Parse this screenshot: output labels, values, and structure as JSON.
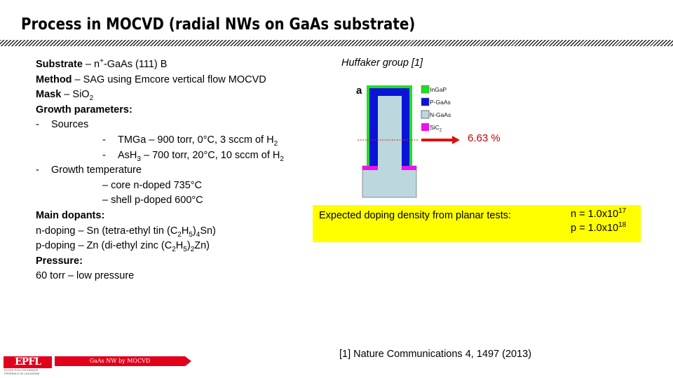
{
  "slide": {
    "title": "Process in MOCVD (radial NWs on GaAs substrate)"
  },
  "left_column": {
    "substrate_label": "Substrate",
    "substrate_value": " – n",
    "substrate_sup": "+",
    "substrate_rest": "-GaAs (111) B",
    "method_label": "Method",
    "method_value": " – SAG using Emcore vertical flow MOCVD",
    "mask_label": "Mask",
    "mask_value": " – SiO",
    "mask_sub": "2",
    "growth_params_label": "Growth parameters:",
    "sources_bullet": "-",
    "sources_label": "Sources",
    "tmga_bullet": "-",
    "tmga_text": "TMGa – 900 torr, 0°C, 3 sccm of H",
    "tmga_sub": "2",
    "ash3_bullet": "-",
    "ash3_a": "AsH",
    "ash3_sub1": "3",
    "ash3_b": " – 700 torr, 20°C, 10 sccm of H",
    "ash3_sub2": "2",
    "growth_temp_bullet": "-",
    "growth_temp_label": "Growth temperature",
    "core_text": "– core n-doped 735°C",
    "shell_text": "– shell p-doped 600°C",
    "dopants_label": "Main dopants:",
    "n_doping_a": "n-doping – Sn (tetra-ethyl tin (C",
    "n_doping_s1": "2",
    "n_doping_b": "H",
    "n_doping_s2": "5",
    "n_doping_c": ")",
    "n_doping_s3": "4",
    "n_doping_d": "Sn)",
    "p_doping_a": "p-doping – Zn (di-ethyl zinc (C",
    "p_doping_s1": "2",
    "p_doping_b": "H",
    "p_doping_s2": "5",
    "p_doping_c": ")",
    "p_doping_s3": "2",
    "p_doping_d": "Zn)",
    "pressure_label": "Pressure:",
    "pressure_value": "60 torr – low pressure"
  },
  "figure": {
    "caption": "Huffaker group [1]",
    "panel_label": "a",
    "legend": [
      {
        "label": "InGaP",
        "color": "#22dd22"
      },
      {
        "label": "P-GaAs",
        "color": "#0a14d8"
      },
      {
        "label": "N-GaAs",
        "color": "#bcd8de"
      },
      {
        "label": "SiC",
        "sub": "2",
        "color": "#ee10ee"
      }
    ],
    "arrow_color": "#e01010",
    "percentage": "6.63 %"
  },
  "highlight": {
    "label": "Expected doping density from planar tests:",
    "n_prefix": "n = 1.0x10",
    "n_exp": "17",
    "p_prefix": "p = 1.0x10",
    "p_exp": "18",
    "color": "#ffff00"
  },
  "reference": "[1] Nature Communications 4, 1497 (2013)",
  "footer": {
    "logo_text": "EPFL",
    "logo_sub1": "ÉCOLE POLYTECHNIQUE",
    "logo_sub2": "FÉDÉRALE DE LAUSANNE",
    "bar_text": "GaAs NW by MOCVD",
    "brand_color": "#e2001a"
  }
}
